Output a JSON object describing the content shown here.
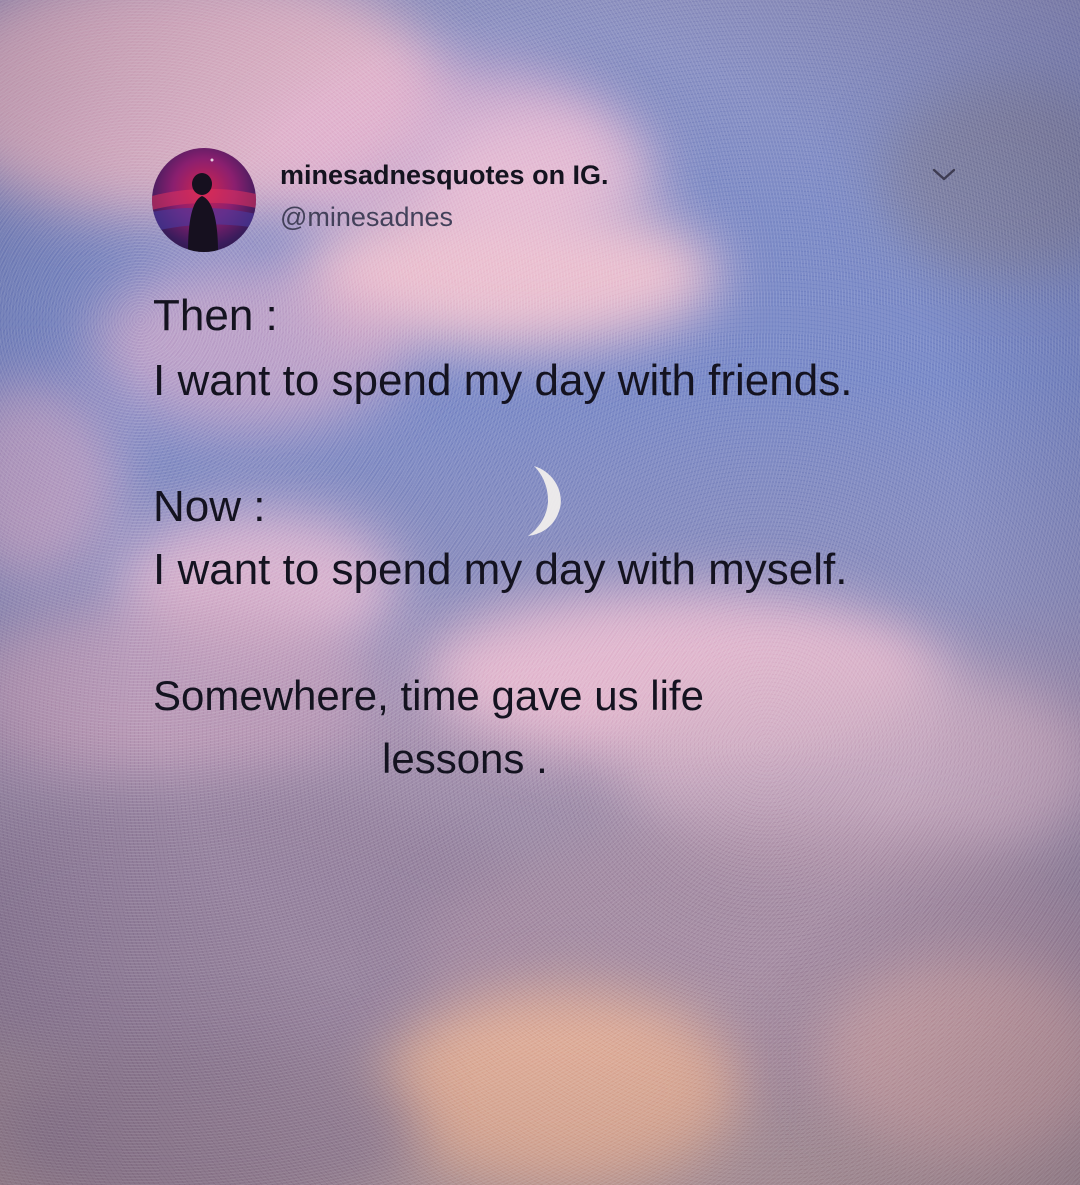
{
  "post": {
    "author": {
      "display_name": "minesadnesquotes on IG.",
      "handle": "@minesadnes"
    },
    "menu_icon": "chevron-down-icon",
    "lines": [
      "Then :",
      "I want to spend my day with friends.",
      "Now :",
      "I want to spend my day with myself.",
      "Somewhere, time gave us life",
      "lessons ."
    ]
  },
  "colors": {
    "text": "#141320",
    "handle": "#43415a",
    "cloud_pink": "#e8b5c8",
    "sky_blue": "#7b8bc8"
  }
}
